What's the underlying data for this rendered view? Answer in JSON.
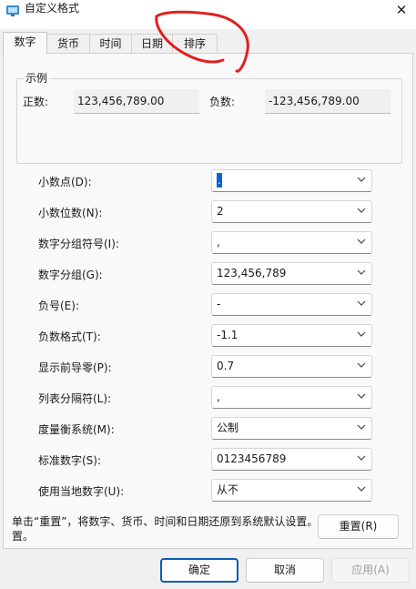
{
  "window": {
    "title": "自定义格式",
    "close_glyph": "✕",
    "icon": "control-panel-icon"
  },
  "tabs": [
    {
      "label": "数字",
      "active": true
    },
    {
      "label": "货币",
      "active": false
    },
    {
      "label": "时间",
      "active": false
    },
    {
      "label": "日期",
      "active": false
    },
    {
      "label": "排序",
      "active": false
    }
  ],
  "sample": {
    "group_title": "示例",
    "positive_label": "正数:",
    "positive_value": "123,456,789.00",
    "negative_label": "负数:",
    "negative_value": "-123,456,789.00"
  },
  "settings": [
    {
      "label": "小数点(D):",
      "value": ".",
      "selected": true
    },
    {
      "label": "小数位数(N):",
      "value": "2"
    },
    {
      "label": "数字分组符号(I):",
      "value": ","
    },
    {
      "label": "数字分组(G):",
      "value": "123,456,789"
    },
    {
      "label": "负号(E):",
      "value": "-"
    },
    {
      "label": "负数格式(T):",
      "value": "-1.1"
    },
    {
      "label": "显示前导零(P):",
      "value": "0.7"
    },
    {
      "label": "列表分隔符(L):",
      "value": ","
    },
    {
      "label": "度量衡系统(M):",
      "value": "公制"
    },
    {
      "label": "标准数字(S):",
      "value": "0123456789"
    },
    {
      "label": "使用当地数字(U):",
      "value": "从不"
    }
  ],
  "footer": {
    "note_line1": "单击“重置”，将数字、货币、时间和日期还原到系统默认设置。",
    "note_line2": "置。",
    "reset_label": "重置(R)"
  },
  "buttons": {
    "ok": "确定",
    "cancel": "取消",
    "apply": "应用(A)"
  },
  "colors": {
    "accent": "#0a5ab8",
    "selection": "#0a64d8",
    "annotation": "#e02020"
  }
}
